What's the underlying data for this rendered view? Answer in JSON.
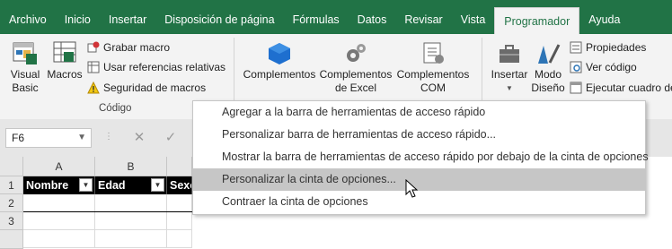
{
  "tabs": [
    "Archivo",
    "Inicio",
    "Insertar",
    "Disposición de página",
    "Fórmulas",
    "Datos",
    "Revisar",
    "Vista",
    "Programador",
    "Ayuda"
  ],
  "active_tab": "Programador",
  "ribbon": {
    "code": {
      "visual_basic": "Visual\nBasic",
      "macros": "Macros",
      "record": "Grabar macro",
      "relative": "Usar referencias relativas",
      "security": "Seguridad de macros",
      "group": "Código"
    },
    "addins": {
      "complementos": "Complementos",
      "excel": "Complementos\nde Excel",
      "com": "Complementos\nCOM"
    },
    "controls": {
      "insert": "Insertar",
      "design": "Modo\nDiseño",
      "properties": "Propiedades",
      "view_code": "Ver código",
      "dialog": "Ejecutar cuadro de"
    }
  },
  "formula_bar": {
    "name_box": "F6",
    "cancel": "✕",
    "enter": "✓"
  },
  "grid": {
    "columns": [
      "A",
      "B"
    ],
    "rows": [
      "1",
      "2",
      "3"
    ],
    "headers": [
      "Nombre",
      "Edad",
      "Sexo"
    ]
  },
  "context_menu": {
    "items": [
      "Agregar a la barra de herramientas de acceso rápido",
      "Personalizar barra de herramientas de acceso rápido...",
      "Mostrar la barra de herramientas de acceso rápido por debajo de la cinta de opciones",
      "Personalizar la cinta de opciones...",
      "Contraer la cinta de opciones"
    ],
    "hover_index": 3
  },
  "colors": {
    "accent": "#217346",
    "menu_hover": "#c6c6c6"
  }
}
